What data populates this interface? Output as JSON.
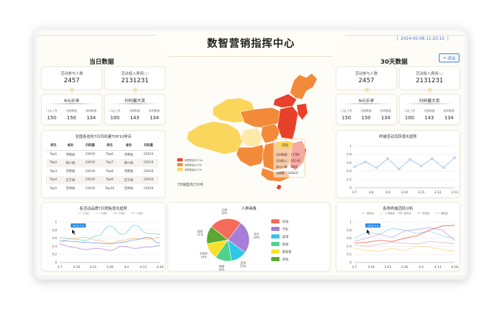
{
  "header": {
    "title": "数智营销指挥中心",
    "datetime": "2024-05-08 11:25:15",
    "exit_label": "退出"
  },
  "left": {
    "section_title": "当日数据",
    "kpis": [
      {
        "label": "活动参与人数",
        "value": "2457"
      },
      {
        "label": "活动投入费用",
        "unit": "(元)",
        "value": "2131231"
      }
    ],
    "stats": [
      {
        "title": "N元乐享",
        "items": [
          {
            "label": "门店上传",
            "value": "150"
          },
          {
            "label": "兑换数量",
            "value": "150"
          },
          {
            "label": "核销数量",
            "value": "134"
          }
        ]
      },
      {
        "title": "扫码赢大奖",
        "items": [
          {
            "label": "门店上传",
            "value": "100"
          },
          {
            "label": "兑换数量",
            "value": "143"
          },
          {
            "label": "核销数量",
            "value": "134"
          }
        ]
      }
    ],
    "rank": {
      "title": "全国各省份7日扫码量TOP10排名",
      "headers": [
        "排名",
        "省份",
        "扫码量",
        "排名",
        "省份",
        "扫码量"
      ],
      "rows": [
        [
          "Top1",
          "河南省",
          "23010",
          "Top6",
          "河南省",
          "23010"
        ],
        [
          "Top2",
          "四川省",
          "23010",
          "Top7",
          "四川省",
          "23010"
        ],
        [
          "Top3",
          "河南省",
          "23010",
          "Top8",
          "河南省",
          "23010"
        ],
        [
          "Top4",
          "辽宁省",
          "23010",
          "Top9",
          "辽宁省",
          "23010"
        ],
        [
          "Top5",
          "吉林省",
          "23010",
          "Top10",
          "吉林省",
          "23010"
        ]
      ]
    }
  },
  "right": {
    "section_title": "30天数据",
    "kpis": [
      {
        "label": "活动参与人数",
        "value": "2457"
      },
      {
        "label": "活动投入费用",
        "unit": "(元)",
        "value": "2131231"
      }
    ],
    "stats": [
      {
        "title": "N元乐享",
        "items": [
          {
            "label": "门店上传",
            "value": "150"
          },
          {
            "label": "兑换数量",
            "value": "150"
          },
          {
            "label": "核销数量",
            "value": "134"
          }
        ]
      },
      {
        "title": "扫码赢大奖",
        "items": [
          {
            "label": "门店上传",
            "value": "100"
          },
          {
            "label": "兑换数量",
            "value": "143"
          },
          {
            "label": "核销数量",
            "value": "134"
          }
        ]
      }
    ]
  },
  "map": {
    "caption": "7日销售热力分布",
    "legend": [
      "销售数量大于1w",
      "销售数量大于5k",
      "销售数量大于1k"
    ],
    "tooltip": {
      "title": "河北",
      "rows": [
        "扫码数量： 17566",
        "活动投入： 522.46",
        "参与人数： 3005",
        "兑换数： 245937"
      ]
    },
    "colors": {
      "high": "#e8412a",
      "mid": "#f28a3a",
      "low": "#fbd65c",
      "pale": "#fde9a8"
    }
  },
  "chart_data": [
    {
      "type": "line",
      "title": "各活动品牌7日销售增长趋势",
      "x": [
        "3.7",
        "3.14",
        "3.21",
        "3.28",
        "4.4",
        "4.11",
        "4.18"
      ],
      "ylim": [
        0,
        1
      ],
      "yticks": [
        "0",
        "0.2",
        "0.4",
        "0.6",
        "0.8",
        "1"
      ],
      "legend": [
        "产品1",
        "产品2",
        "产品3",
        "产品4"
      ],
      "tooltip_label": "2023.7.6",
      "series": [
        {
          "name": "产品1",
          "color": "#7fd8e0",
          "values": [
            0.62,
            0.58,
            0.55,
            0.66,
            0.9,
            0.7,
            0.92,
            0.72,
            0.7
          ]
        },
        {
          "name": "产品2",
          "color": "#f7c27a",
          "values": [
            0.5,
            0.6,
            0.62,
            0.55,
            0.48,
            0.55,
            0.6,
            0.58,
            0.62
          ]
        },
        {
          "name": "产品3",
          "color": "#7aa7f0",
          "values": [
            0.55,
            0.52,
            0.5,
            0.48,
            0.46,
            0.5,
            0.56,
            0.62,
            0.48
          ]
        },
        {
          "name": "产品4",
          "color": "#b793e6",
          "values": [
            0.45,
            0.38,
            0.32,
            0.35,
            0.3,
            0.4,
            0.35,
            0.38,
            0.42
          ]
        }
      ]
    },
    {
      "type": "pie",
      "title": "人群画像",
      "slices": [
        {
          "label": "白领",
          "value": 20,
          "pct": "20%",
          "color": "#f26b5b"
        },
        {
          "label": "学生",
          "value": 20,
          "pct": "20%",
          "color": "#a67ed8"
        },
        {
          "label": "蓝领",
          "value": 10,
          "pct": "10%",
          "color": "#2fc6e8"
        },
        {
          "label": "商旅",
          "value": 10,
          "pct": "10%",
          "color": "#4ed38a"
        },
        {
          "label": "中老年",
          "value": 10,
          "pct": "10%",
          "color": "#f7e12a"
        },
        {
          "label": "其他",
          "value": 11,
          "pct": "11%",
          "color": "#5aa832"
        }
      ],
      "legend": [
        "白领",
        "学生",
        "蓝领",
        "商旅",
        "家庭客",
        "其他"
      ]
    },
    {
      "type": "line",
      "title": "终端活动活跃增长趋势",
      "x": [
        "3.7",
        "3.8",
        "3.9",
        "3.10",
        "3.11",
        "3.12",
        "3.13"
      ],
      "ylim": [
        0,
        1
      ],
      "yticks": [
        "0",
        "0.2",
        "0.4",
        "0.6",
        "0.8",
        "1"
      ],
      "series": [
        {
          "name": "",
          "color": "#6aa7e6",
          "values": [
            0.5,
            0.62,
            0.48,
            0.7,
            0.45,
            0.68,
            0.52,
            0.7,
            0.48,
            0.72
          ]
        }
      ]
    },
    {
      "type": "line",
      "title": "各类终端活跃分析",
      "x": [
        "3.7",
        "3.14",
        "3.21",
        "3.28",
        "4.4",
        "4.11",
        "4.18"
      ],
      "ylim": [
        0,
        1
      ],
      "yticks": [
        "0",
        "0.2",
        "0.4",
        "0.6",
        "0.8",
        "1"
      ],
      "legend": [
        "便利店",
        "小卖部店",
        "超市店",
        "商场店",
        "餐饮店"
      ],
      "tooltip_label": "2023.7.6",
      "series": [
        {
          "name": "便利店",
          "color": "#7fd8e0",
          "values": [
            0.6,
            0.75,
            0.7,
            0.85,
            0.8,
            0.72,
            0.78,
            0.66,
            0.6
          ]
        },
        {
          "name": "小卖部店",
          "color": "#f7d46a",
          "values": [
            0.35,
            0.3,
            0.28,
            0.35,
            0.3,
            0.4,
            0.38,
            0.32,
            0.28
          ]
        },
        {
          "name": "超市店",
          "color": "#e8412a",
          "values": [
            0.48,
            0.5,
            0.55,
            0.52,
            0.6,
            0.66,
            0.8,
            0.9,
            0.92
          ]
        },
        {
          "name": "商场店",
          "color": "#b793e6",
          "values": [
            0.52,
            0.6,
            0.7,
            0.62,
            0.78,
            0.82,
            0.86,
            0.8,
            0.55
          ]
        },
        {
          "name": "餐饮店",
          "color": "#f2a0c0",
          "values": [
            0.44,
            0.4,
            0.45,
            0.5,
            0.48,
            0.46,
            0.52,
            0.5,
            0.46
          ]
        }
      ]
    }
  ]
}
